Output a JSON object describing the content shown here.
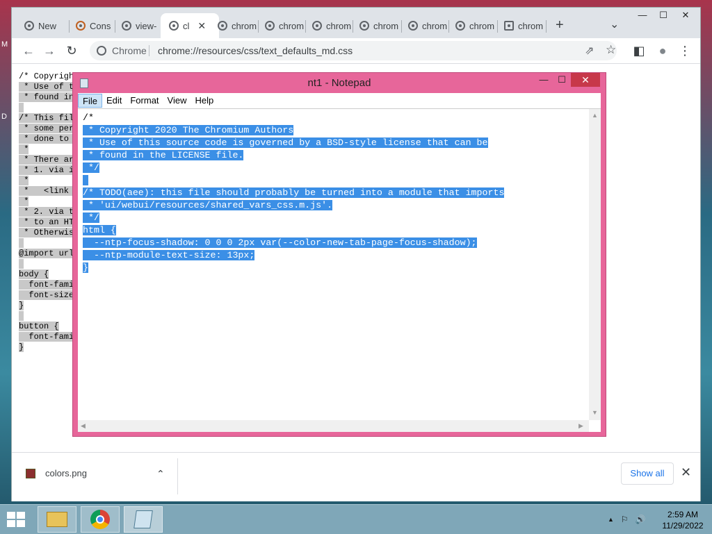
{
  "desktop": {
    "icon_letters": [
      "M",
      "D"
    ]
  },
  "chrome": {
    "tabs": [
      {
        "label": "New",
        "icon": "chrome-icon"
      },
      {
        "label": "Cons",
        "icon": "console-icon"
      },
      {
        "label": "view-",
        "icon": "chrome-icon"
      },
      {
        "label": "cl",
        "icon": "chrome-icon",
        "active": true
      },
      {
        "label": "chrom",
        "icon": "chrome-icon"
      },
      {
        "label": "chrom",
        "icon": "chrome-icon"
      },
      {
        "label": "chrom",
        "icon": "chrome-icon"
      },
      {
        "label": "chrom",
        "icon": "chrome-icon"
      },
      {
        "label": "chrom",
        "icon": "chrome-icon"
      },
      {
        "label": "chrom",
        "icon": "chrome-icon"
      },
      {
        "label": "chrom",
        "icon": "extension-icon"
      }
    ],
    "new_tab_symbol": "+",
    "tab_search_symbol": "⌄",
    "window_controls": {
      "minimize": "—",
      "maximize": "☐",
      "close": "✕"
    },
    "toolbar": {
      "back": "←",
      "forward": "→",
      "reload": "↻",
      "chip_label": "Chrome",
      "url": "chrome://resources/css/text_defaults_md.css",
      "share": "⇗",
      "bookmark": "☆",
      "sidepanel": "◧",
      "profile": "●",
      "menu": "⋮"
    },
    "page_source_lines": [
      "/* Copyright",
      " * Use of t",
      " * found in",
      " ",
      "/* This fil",
      " * some per",
      " * done to ",
      " *",
      " * There ar",
      " * 1. via i",
      " *",
      " *   <link ",
      " *",
      " * 2. via t",
      " * to an HT",
      " * Otherwis",
      "",
      "@import url",
      "",
      "body {",
      "  font-fami",
      "  font-size",
      "}",
      "",
      "button {",
      "  font-fami",
      "}"
    ],
    "download": {
      "file_name": "colors.png",
      "chevron": "⌃",
      "show_all": "Show all",
      "close": "✕"
    }
  },
  "notepad": {
    "title": "nt1 - Notepad",
    "controls": {
      "minimize": "—",
      "maximize": "☐",
      "close": "✕"
    },
    "menu": [
      "File",
      "Edit",
      "Format",
      "View",
      "Help"
    ],
    "lines": [
      {
        "text": "/*",
        "selected": false
      },
      {
        "text": " * Copyright 2020 The Chromium Authors",
        "selected": true
      },
      {
        "text": " * Use of this source code is governed by a BSD-style license that can be",
        "selected": true
      },
      {
        "text": " * found in the LICENSE file.",
        "selected": true
      },
      {
        "text": " */",
        "selected": true
      },
      {
        "text": "",
        "selected": true
      },
      {
        "text": "/* TODO(aee): this file should probably be turned into a module that imports",
        "selected": true
      },
      {
        "text": " * 'ui/webui/resources/shared_vars_css.m.js'.",
        "selected": true
      },
      {
        "text": " */",
        "selected": true
      },
      {
        "text": "html {",
        "selected": true
      },
      {
        "text": "  --ntp-focus-shadow: 0 0 0 2px var(--color-new-tab-page-focus-shadow);",
        "selected": true
      },
      {
        "text": "  --ntp-module-text-size: 13px;",
        "selected": true
      },
      {
        "text": "}",
        "selected": true
      }
    ]
  },
  "taskbar": {
    "clock_time": "2:59 AM",
    "clock_date": "11/29/2022",
    "tray": [
      "▲",
      "⚐",
      "🔊"
    ]
  }
}
